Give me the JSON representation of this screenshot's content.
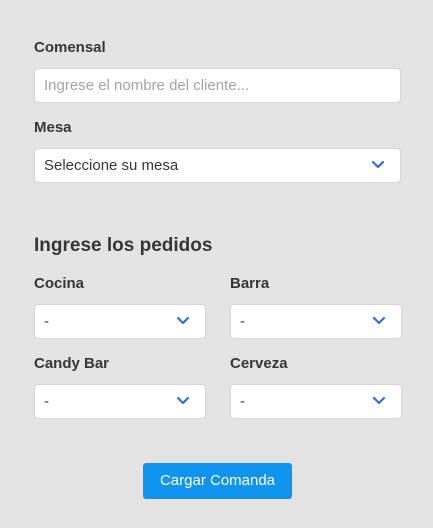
{
  "comensal": {
    "label": "Comensal",
    "placeholder": "Ingrese el nombre del cliente...",
    "value": ""
  },
  "mesa": {
    "label": "Mesa",
    "selected": "Seleccione su mesa"
  },
  "pedidos": {
    "title": "Ingrese los pedidos",
    "cocina": {
      "label": "Cocina",
      "selected": "-"
    },
    "barra": {
      "label": "Barra",
      "selected": "-"
    },
    "candy_bar": {
      "label": "Candy Bar",
      "selected": "-"
    },
    "cerveza": {
      "label": "Cerveza",
      "selected": "-"
    }
  },
  "submit": {
    "label": "Cargar Comanda"
  },
  "colors": {
    "background": "#e3e3e3",
    "accent": "#0f95f0",
    "chevron": "#2f6fd6"
  },
  "icons": {
    "dropdown": "chevron-down-icon"
  }
}
